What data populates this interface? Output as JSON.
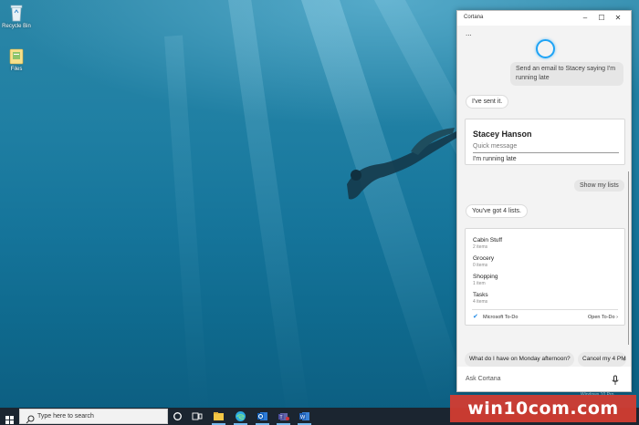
{
  "desktop": {
    "icons": [
      {
        "label": "Recycle Bin",
        "icon": "recycle-bin-icon"
      },
      {
        "label": "Files",
        "icon": "folder-icon"
      }
    ]
  },
  "cortana": {
    "title": "Cortana",
    "more_label": "...",
    "user_message_1": "Send an email to Stacey saying I'm running late",
    "reply_1": "I've sent it.",
    "contact_card": {
      "name": "Stacey Hanson",
      "field_label": "Quick message",
      "field_value": "I'm running late"
    },
    "user_message_2": "Show my lists",
    "reply_2": "You've got 4 lists.",
    "lists": [
      {
        "name": "Cabin Stuff",
        "count": "2 items"
      },
      {
        "name": "Grocery",
        "count": "0 items"
      },
      {
        "name": "Shopping",
        "count": "1 item"
      },
      {
        "name": "Tasks",
        "count": "4 items"
      }
    ],
    "lists_source": "Microsoft To-Do",
    "open_link": "Open To-Do ›",
    "suggestions": [
      {
        "label": "What do I have on Monday afternoon?"
      },
      {
        "label": "Cancel my 4 PM"
      }
    ],
    "ask_placeholder": "Ask Cortana",
    "accent_color": "#1ea3f5"
  },
  "taskbar": {
    "search_placeholder": "Type here to search",
    "icons": [
      "start-icon",
      "cortana-circle-icon",
      "task-view-icon",
      "file-explorer-icon",
      "edge-icon",
      "outlook-icon",
      "teams-icon",
      "word-icon"
    ],
    "windows_version": "Windows 10 Pro"
  },
  "watermark": "win10com.com"
}
